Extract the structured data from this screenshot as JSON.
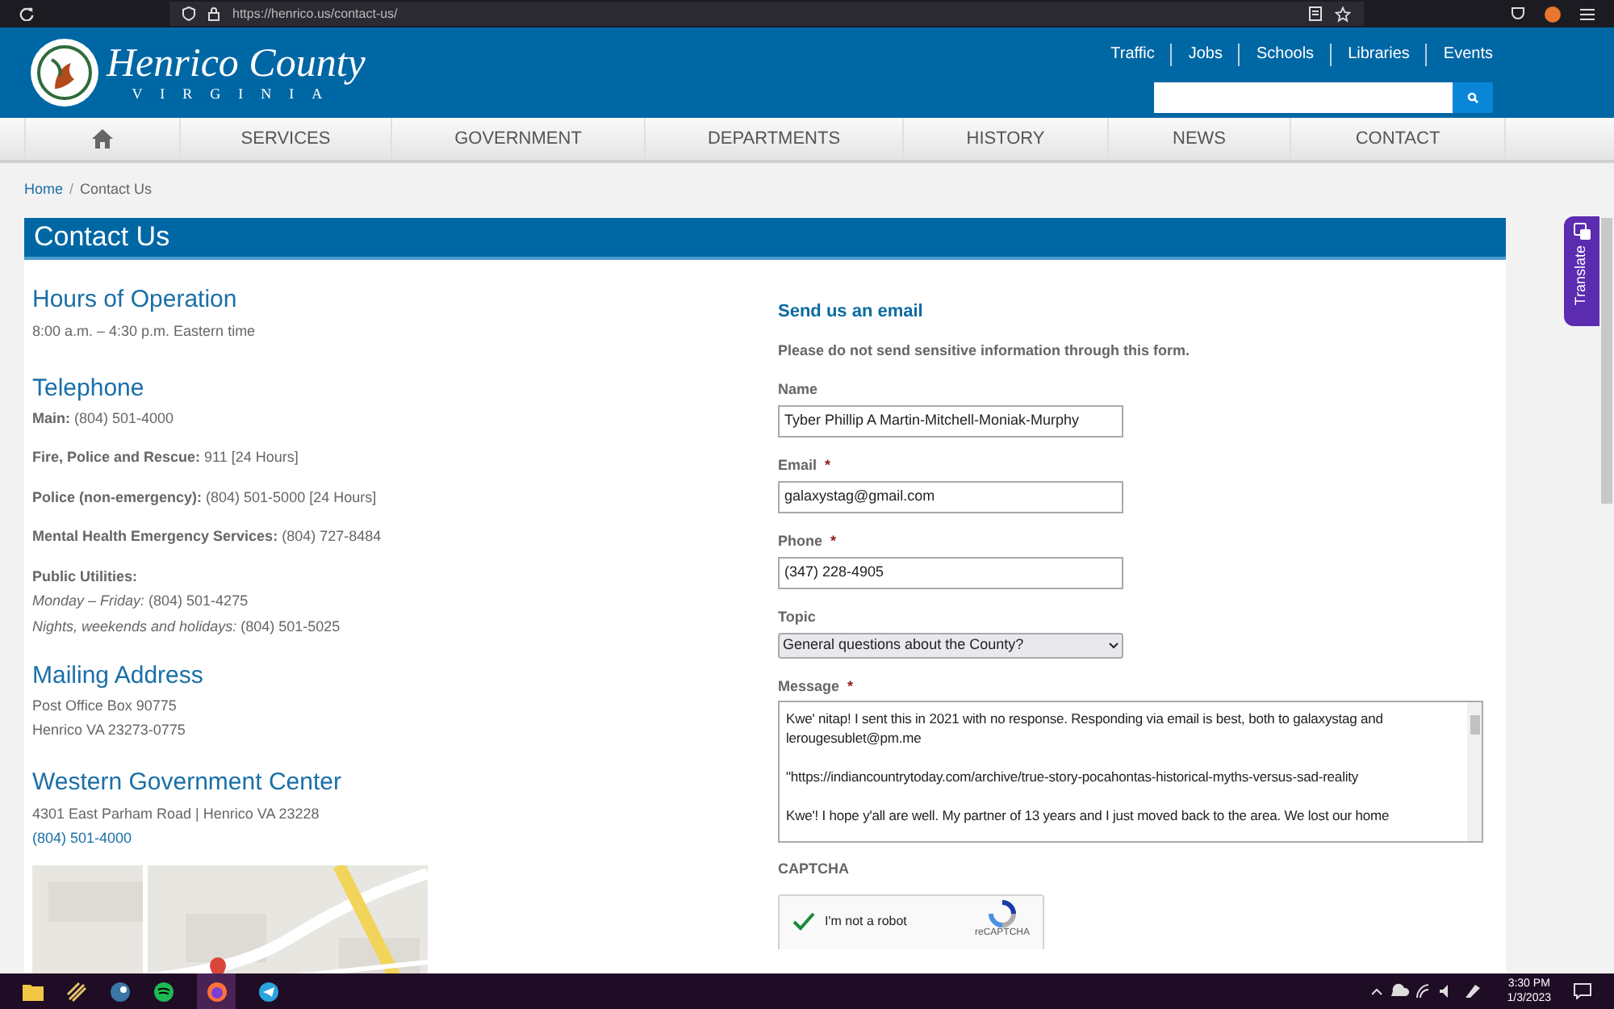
{
  "browser": {
    "url": "https://henrico.us/contact-us/"
  },
  "header": {
    "title": "Henrico County",
    "subtitle": "VIRGINIA",
    "top_links": [
      "Traffic",
      "Jobs",
      "Schools",
      "Libraries",
      "Events"
    ]
  },
  "nav": [
    {
      "label": "SERVICES"
    },
    {
      "label": "GOVERNMENT"
    },
    {
      "label": "DEPARTMENTS"
    },
    {
      "label": "HISTORY"
    },
    {
      "label": "NEWS"
    },
    {
      "label": "CONTACT"
    }
  ],
  "breadcrumb": {
    "separator": "/",
    "items": [
      {
        "label": "Home",
        "kind": "link"
      },
      {
        "label": "Contact Us",
        "kind": "current"
      }
    ]
  },
  "page_title": "Contact Us",
  "hours": {
    "heading": "Hours of Operation",
    "text": "8:00 a.m. – 4:30 p.m. Eastern time"
  },
  "telephone": {
    "heading": "Telephone",
    "entries": [
      {
        "label": "Main:",
        "value": "(804) 501-4000"
      },
      {
        "label": "Fire, Police and Rescue:",
        "value": "911 [24 Hours]"
      },
      {
        "label": "Police (non-emergency):",
        "value": "(804) 501-5000 [24 Hours]"
      },
      {
        "label": "Mental Health Emergency Services:",
        "value": "(804) 727-8484"
      }
    ],
    "utilities": {
      "label": "Public Utilities:",
      "lines": [
        {
          "label": "Monday – Friday:",
          "value": "(804) 501-4275"
        },
        {
          "label": "Nights, weekends and holidays:",
          "value": "(804) 501-5025"
        }
      ]
    }
  },
  "mailing": {
    "heading": "Mailing Address",
    "lines": [
      "Post Office Box 90775",
      "Henrico VA 23273-0775"
    ]
  },
  "western": {
    "heading": "Western Government Center",
    "address": "4301 East Parham Road | Henrico VA 23228",
    "phone": "(804) 501-4000"
  },
  "form": {
    "heading": "Send us an email",
    "notice": "Please do not send sensitive information through this form.",
    "fields": [
      {
        "kind": "text",
        "label": "Name",
        "value": "Tyber Phillip A Martin-Mitchell-Moniak-Murphy"
      },
      {
        "kind": "text",
        "label": "Email",
        "required_mark": "*",
        "value": "galaxystag@gmail.com"
      },
      {
        "kind": "text",
        "label": "Phone",
        "required_mark": "*",
        "value": "(347) 228-4905"
      },
      {
        "kind": "select",
        "label": "Topic",
        "value": "General questions about the County?"
      },
      {
        "kind": "textarea",
        "label": "Message",
        "required_mark": "*",
        "paragraphs": [
          "Kwe' nitap! I sent this in 2021 with no response. Responding via email is best, both to galaxystag and lerougesublet@pm.me",
          "\"https://indiancountrytoday.com/archive/true-story-pocahontas-historical-myths-versus-sad-reality",
          "Kwe'! I hope y'all are well. My partner of 13 years and I just moved back to the area. We lost our home"
        ]
      }
    ],
    "captcha": {
      "label": "CAPTCHA",
      "checkbox_label": "I'm not a robot",
      "checked": true,
      "brand": "reCAPTCHA"
    }
  },
  "translate": {
    "label": "Translate"
  },
  "taskbar": {
    "time": "3:30 PM",
    "date": "1/3/2023"
  }
}
